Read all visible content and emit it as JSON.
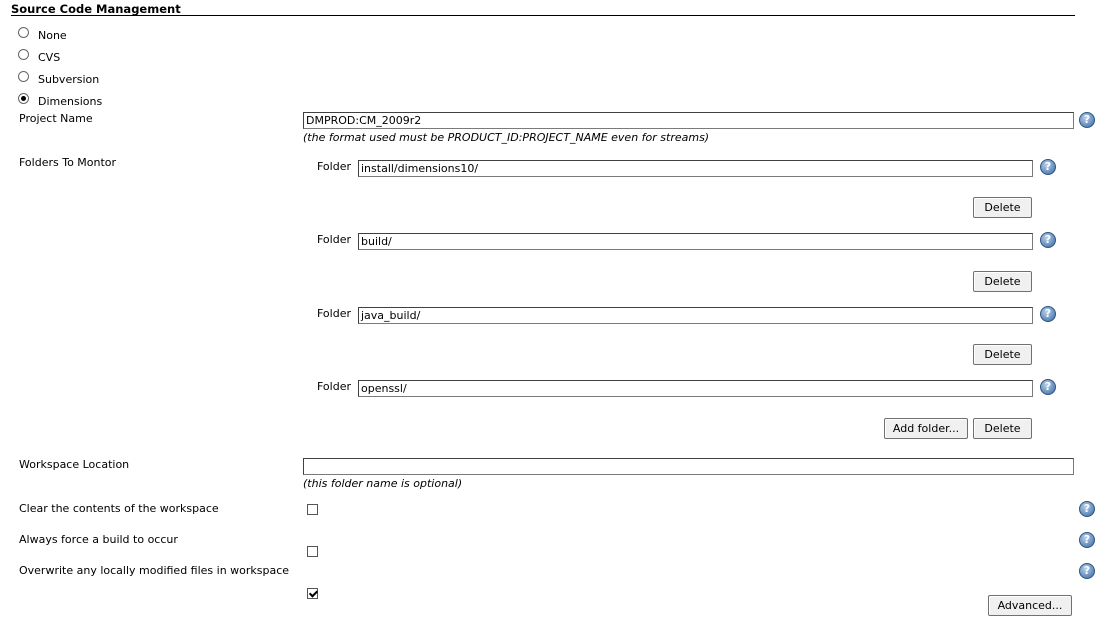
{
  "section": {
    "title": "Source Code Management"
  },
  "scm_options": [
    {
      "label": "None",
      "selected": false
    },
    {
      "label": "CVS",
      "selected": false
    },
    {
      "label": "Subversion",
      "selected": false
    },
    {
      "label": "Dimensions",
      "selected": true
    }
  ],
  "project": {
    "label": "Project Name",
    "value": "DMPROD:CM_2009r2",
    "hint": "(the format used must be PRODUCT_ID:PROJECT_NAME even for streams)"
  },
  "folders": {
    "label": "Folders To Montor",
    "items": [
      {
        "label": "Folder",
        "value": "install/dimensions10/",
        "delete_label": "Delete"
      },
      {
        "label": "Folder",
        "value": "build/",
        "delete_label": "Delete"
      },
      {
        "label": "Folder",
        "value": "java_build/",
        "delete_label": "Delete"
      },
      {
        "label": "Folder",
        "value": "openssl/",
        "delete_label": "Delete"
      }
    ],
    "add_label": "Add folder..."
  },
  "workspace": {
    "label": "Workspace Location",
    "value": "",
    "hint": "(this folder name is optional)"
  },
  "options": [
    {
      "label": "Clear the contents of the workspace",
      "checked": false
    },
    {
      "label": "Always force a build to occur",
      "checked": false
    },
    {
      "label": "Overwrite any locally modified files in workspace",
      "checked": true
    }
  ],
  "help_glyph": "?",
  "advanced_label": "Advanced..."
}
